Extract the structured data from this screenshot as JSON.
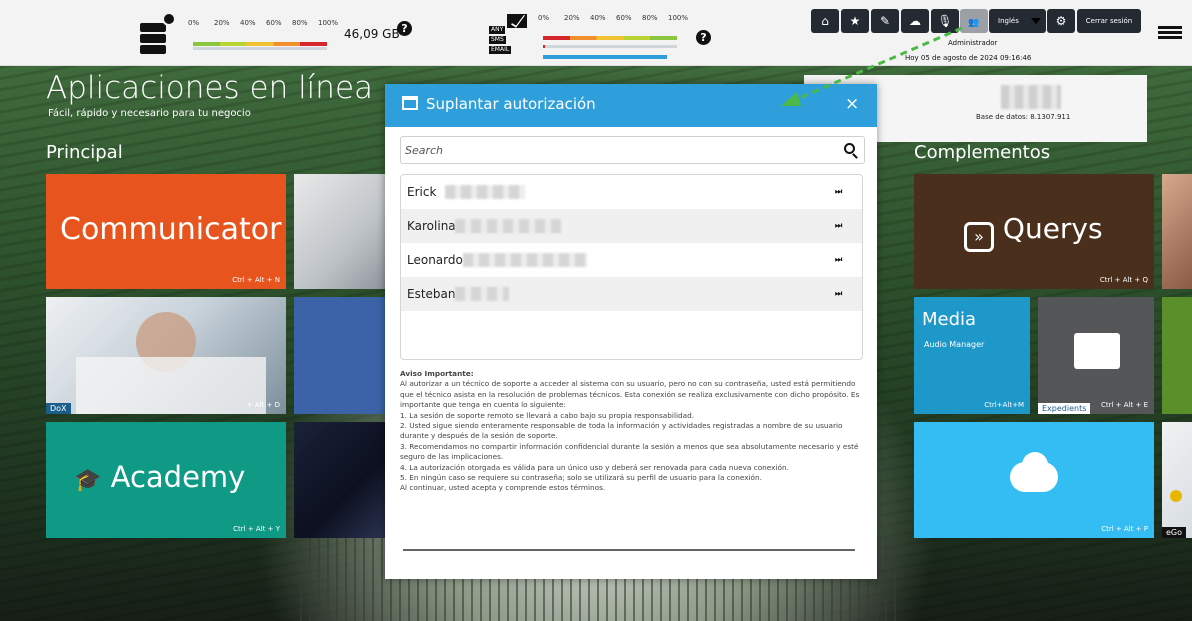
{
  "topbar": {
    "disk_scale": [
      "0%",
      "20%",
      "40%",
      "60%",
      "80%",
      "100%"
    ],
    "disk_size": "46,09 GB",
    "disk_help": "?",
    "msg_scale": [
      "0%",
      "20%",
      "40%",
      "60%",
      "80%",
      "100%"
    ],
    "msg_tags": [
      "ANY",
      "SMS",
      "EMAIL"
    ],
    "msg_help": "?",
    "language": "Inglés",
    "logout": "Cerrar sesión",
    "user_role": "Administrador",
    "user_date": "Hoy 05 de agosto de 2024 09:16:46"
  },
  "main": {
    "title": "Aplicaciones en línea",
    "subtitle": "Fácil, rápido y necesario para tu negocio",
    "principal": "Principal",
    "complementos": "Complementos",
    "db_label": "Base de datos: 8.1307.911"
  },
  "tiles": {
    "communicator": "Communicator",
    "communicator_sc": "Ctrl + Alt + N",
    "dox": "DoX",
    "dox_sc": "+ Alt + D",
    "academy": "Academy",
    "academy_sc": "Ctrl + Alt + Y",
    "querys": "Querys",
    "querys_sc": "Ctrl + Alt + Q",
    "media": "Media",
    "media_sub": "Audio Manager",
    "media_sc": "Ctrl+Alt+M",
    "expedients": "Expedients",
    "expedients_sc": "Ctrl + Alt + E",
    "cloud_sc": "Ctrl + Alt + P",
    "ego": "eGo"
  },
  "modal": {
    "title": "Suplantar autorización",
    "close": "×",
    "search_placeholder": "Search",
    "users": [
      {
        "name": "Erick"
      },
      {
        "name": "Karolina"
      },
      {
        "name": "Leonardo"
      },
      {
        "name": "Esteban"
      }
    ],
    "row_action": "⏭",
    "notice_title": "Aviso Importante:",
    "notice_intro": "Al autorizar a un técnico de soporte a acceder al sistema con su usuario, pero no con su contraseña, usted está permitiendo que el técnico asista en la resolución de problemas técnicos. Esta conexión se realiza exclusivamente con dicho propósito. Es importante que tenga en cuenta lo siguiente:",
    "notice_items": [
      "1. La sesión de soporte remoto se llevará a cabo bajo su propia responsabilidad.",
      "2. Usted sigue siendo enteramente responsable de toda la información y actividades registradas a nombre de su usuario durante y después de la sesión de soporte.",
      "3. Recomendamos no compartir información confidencial durante la sesión a menos que sea absolutamente necesario y esté seguro de las implicaciones.",
      "4. La autorización otorgada es válida para un único uso y deberá ser renovada para cada nueva conexión.",
      "5. En ningún caso se requiere su contraseña; solo se utilizará su perfil de usuario para la conexión."
    ],
    "notice_outro": "Al continuar, usted acepta y comprende estos términos."
  },
  "icons": [
    "home-icon",
    "star-icon",
    "pin-icon",
    "cloud-icon",
    "microphone-icon",
    "users-icon",
    "gear-icon"
  ],
  "colors": {
    "modal_header": "#2f9fdb",
    "communicator": "#e8541e",
    "academy": "#0f9a86",
    "querys": "#4a2f1c",
    "media": "#1e97c9",
    "cloud_tile": "#33bdf2",
    "arrow": "#4cb848"
  }
}
